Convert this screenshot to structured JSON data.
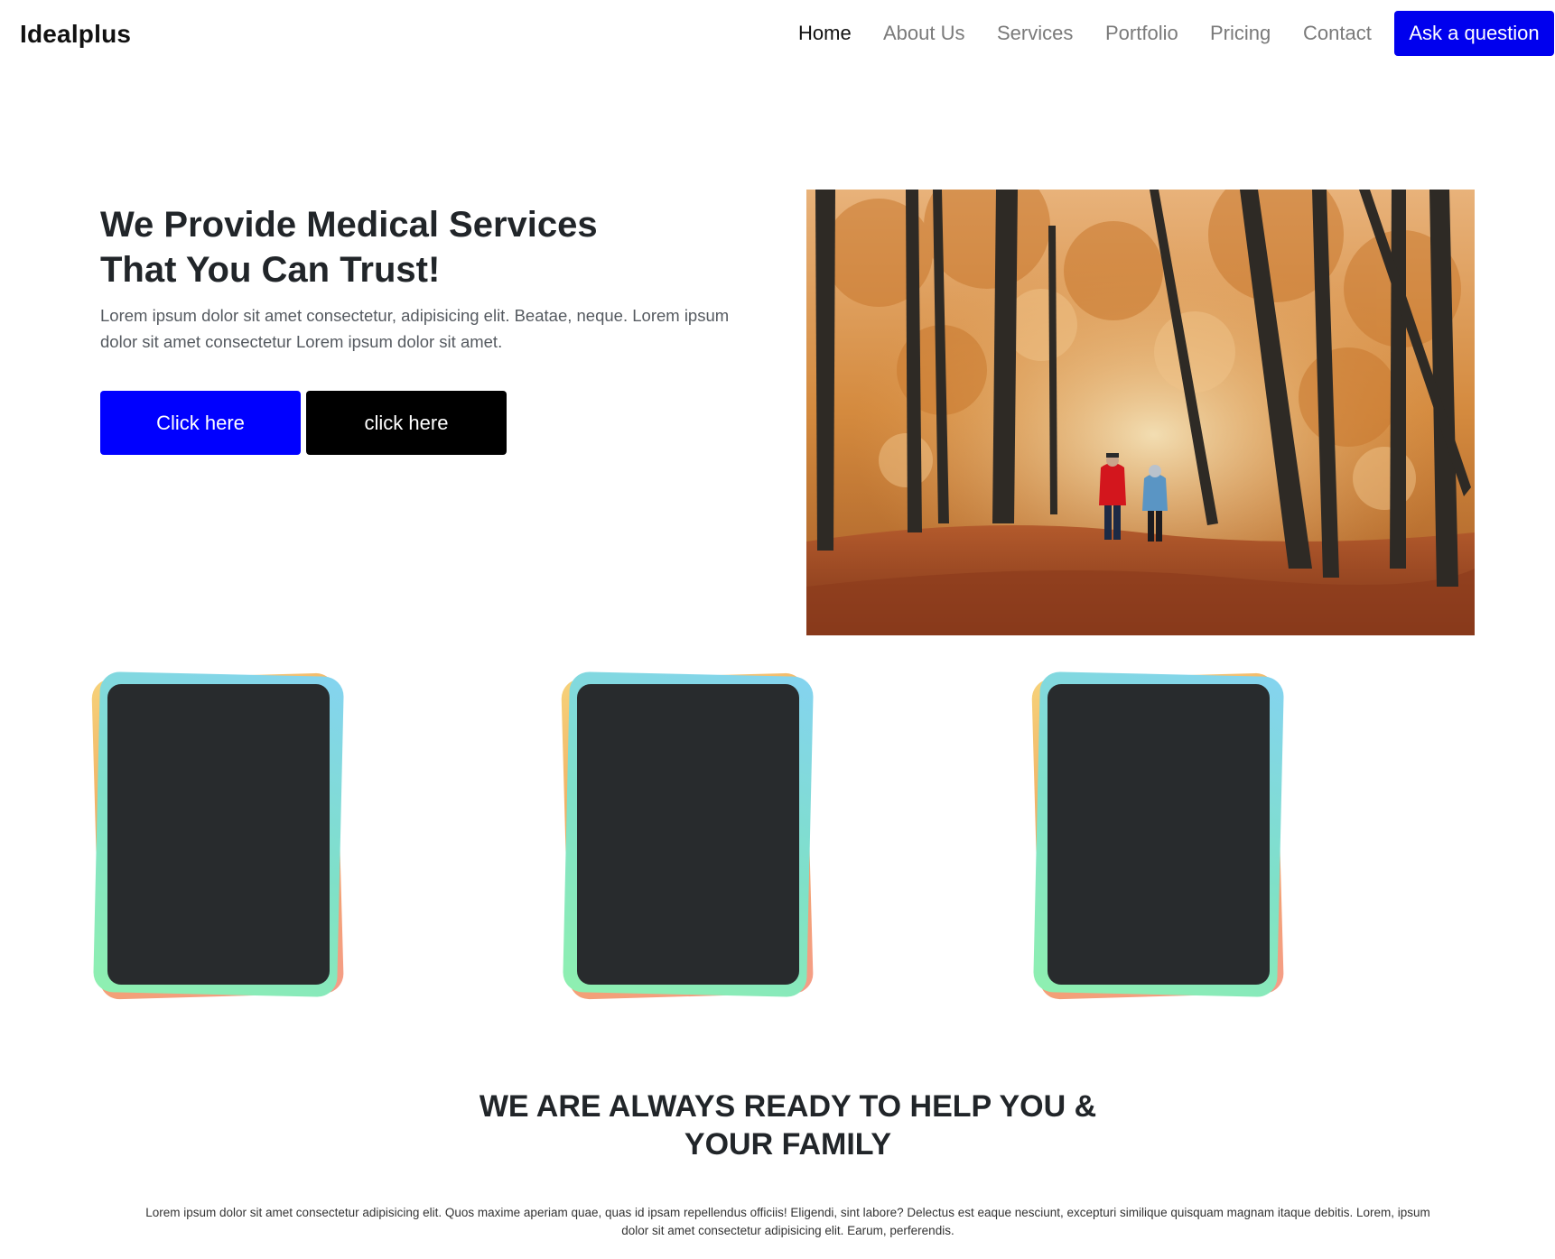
{
  "navbar": {
    "brand": "Idealplus",
    "links": [
      {
        "label": "Home",
        "active": true
      },
      {
        "label": "About Us",
        "active": false
      },
      {
        "label": "Services",
        "active": false
      },
      {
        "label": "Portfolio",
        "active": false
      },
      {
        "label": "Pricing",
        "active": false
      },
      {
        "label": "Contact",
        "active": false
      }
    ],
    "cta_label": "Ask a question"
  },
  "hero": {
    "title_line1": "We Provide Medical Services",
    "title_line2": "That You Can Trust!",
    "text": "Lorem ipsum dolor sit amet consectetur, adipisicing elit. Beatae, neque. Lorem ipsum dolor sit amet consectetur Lorem ipsum dolor sit amet.",
    "primary_button": "Click here",
    "secondary_button": "click here"
  },
  "cards": [
    {},
    {},
    {}
  ],
  "callout": {
    "title_line1": "WE ARE ALWAYS READY TO HELP YOU &",
    "title_line2": "YOUR FAMILY",
    "text": "Lorem ipsum dolor sit amet consectetur adipisicing elit. Quos maxime aperiam quae, quas id ipsam repellendus officiis! Eligendi, sint labore? Delectus est eaque nesciunt, excepturi similique quisquam magnam itaque debitis. Lorem, ipsum dolor sit amet consectetur adipisicing elit. Earum, perferendis."
  },
  "colors": {
    "primary_blue": "#0000ff",
    "cta_blue": "#0000ee",
    "dark_button": "#000000",
    "card_inner": "#282b2d"
  }
}
